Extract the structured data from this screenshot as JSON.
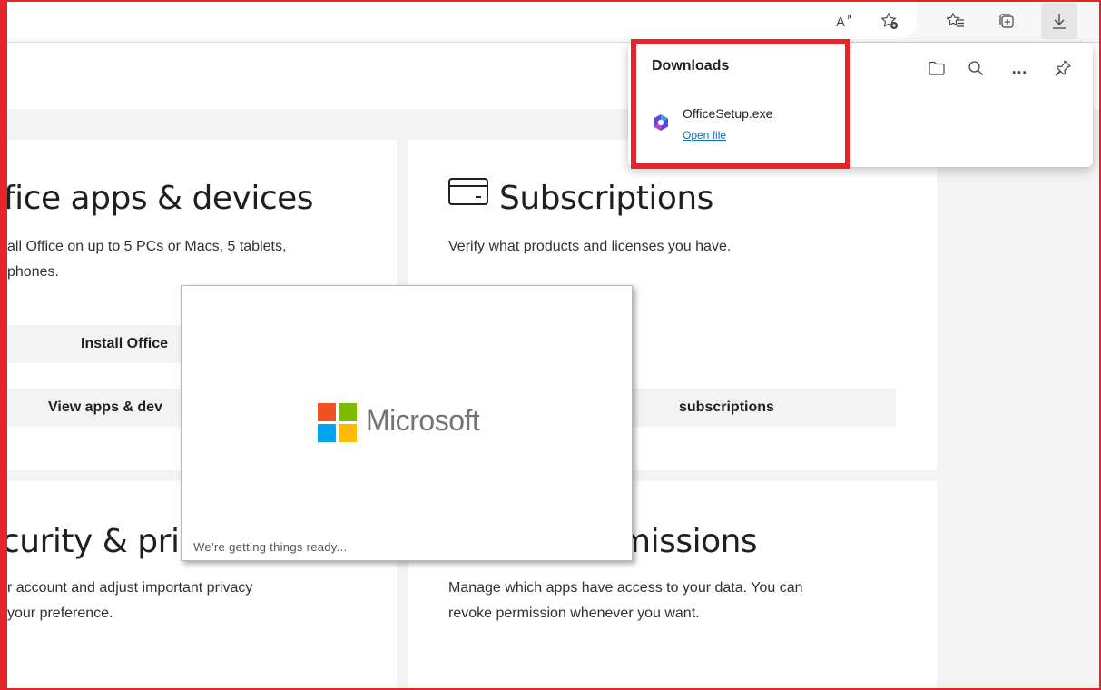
{
  "toolbar": {
    "icons": [
      "read-aloud-icon",
      "add-favorite-icon",
      "favorites-icon",
      "collections-icon",
      "downloads-icon"
    ],
    "read_aloud_glyph": "A"
  },
  "cards": {
    "office_apps": {
      "title": "fice apps & devices",
      "description_line1": "all Office on up to 5 PCs or Macs, 5 tablets,",
      "description_line2": "phones.",
      "install_button": "Install Office",
      "view_button": "View apps & dev"
    },
    "subscriptions": {
      "title": "Subscriptions",
      "icon": "card-icon",
      "description": "Verify what products and licenses you have.",
      "view_button": "subscriptions"
    },
    "security": {
      "title": "curity & pri",
      "description_line1": "r account and adjust important privacy",
      "description_line2": "your preference."
    },
    "permissions": {
      "title": "missions",
      "description_line1": "Manage which apps have access to your data. You can",
      "description_line2": "revoke permission whenever you want."
    }
  },
  "splash": {
    "brand": "Microsoft",
    "status": "We’re getting things ready..."
  },
  "downloads": {
    "title": "Downloads",
    "actions": [
      "open-folder-icon",
      "search-icon",
      "more-icon",
      "pin-icon"
    ],
    "more_glyph": "…",
    "item": {
      "filename": "OfficeSetup.exe",
      "action": "Open file"
    }
  },
  "colors": {
    "highlight": "#e3242b",
    "link": "#0f6cbd",
    "ms_red": "#f25022",
    "ms_green": "#7fba00",
    "ms_blue": "#00a4ef",
    "ms_yellow": "#ffb900"
  }
}
